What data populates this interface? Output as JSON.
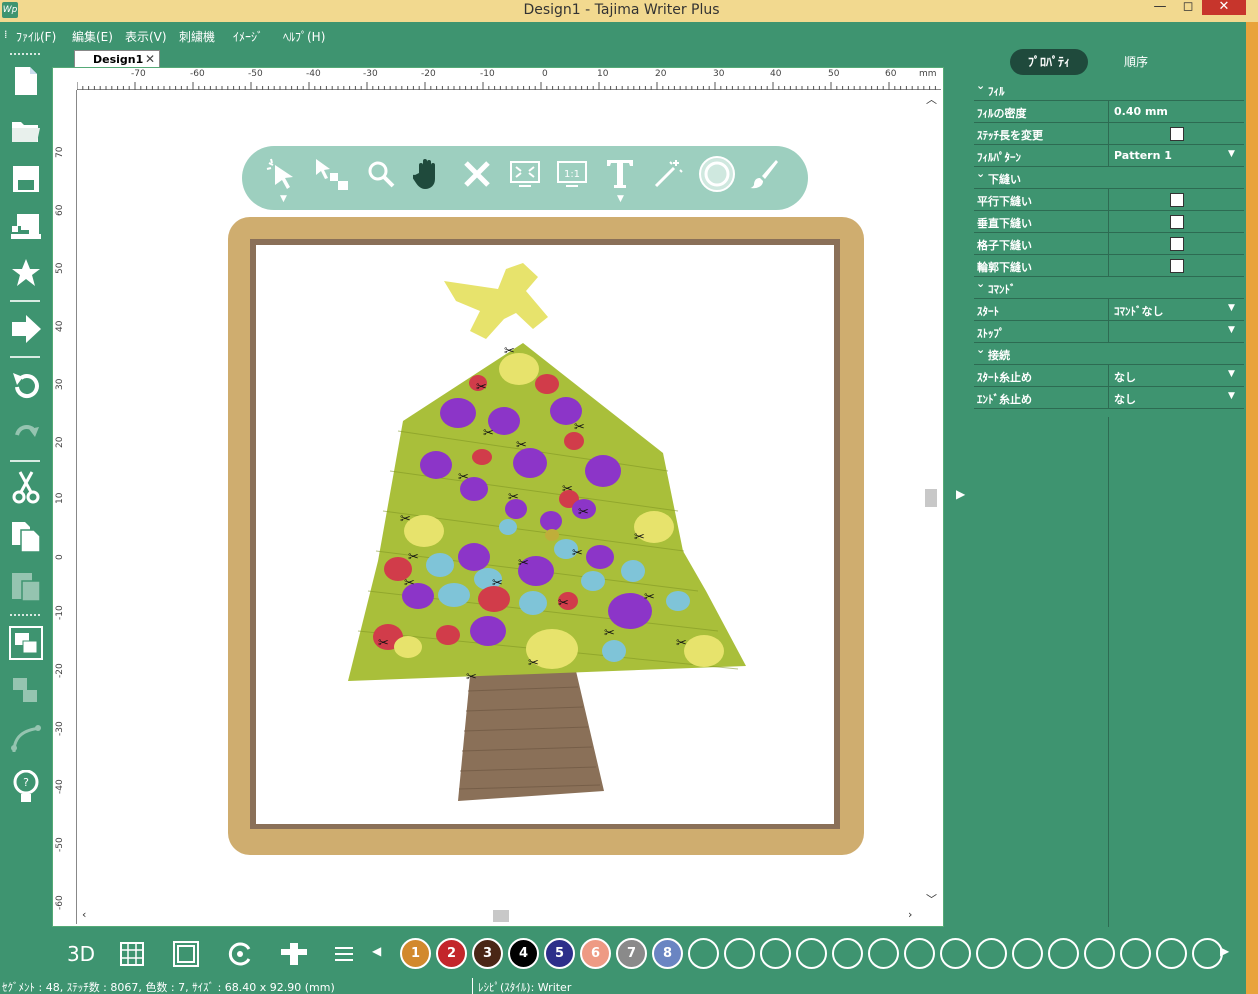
{
  "window": {
    "title": "Design1 - Tajima Writer Plus",
    "app_icon": "Wp",
    "minimize": "—",
    "maximize": "◻",
    "close": "✕"
  },
  "menu": [
    "ﾌｧｲﾙ(F)",
    "編集(E)",
    "表示(V)",
    "刺繍機",
    "ｲﾒｰｼﾞ",
    "ﾍﾙﾌﾟ(H)"
  ],
  "document": {
    "tab_label": "Design1",
    "ruler_unit": "mm",
    "ruler_top_ticks": [
      "-70",
      "-60",
      "-50",
      "-40",
      "-30",
      "-20",
      "-10",
      "0",
      "10",
      "20",
      "30",
      "40",
      "50",
      "60"
    ],
    "ruler_left_ticks": [
      "70",
      "60",
      "50",
      "40",
      "30",
      "20",
      "10",
      "0",
      "-10",
      "-20",
      "-30",
      "-40",
      "-50",
      "-60"
    ]
  },
  "left_toolbar": [
    {
      "icon": "new-file-icon"
    },
    {
      "icon": "open-folder-icon"
    },
    {
      "icon": "save-icon"
    },
    {
      "icon": "sewing-machine-icon"
    },
    {
      "icon": "star-icon"
    },
    {
      "icon": "export-icon"
    },
    {
      "icon": "undo-icon"
    },
    {
      "icon": "redo-icon"
    },
    {
      "icon": "cut-icon"
    },
    {
      "icon": "copy-icon"
    },
    {
      "icon": "paste-icon"
    },
    {
      "icon": "group-icon"
    },
    {
      "icon": "ungroup-icon"
    },
    {
      "icon": "node-edit-icon"
    },
    {
      "icon": "tip-bulb-icon"
    }
  ],
  "float_toolbar": [
    {
      "icon": "magic-select-icon"
    },
    {
      "icon": "select-icon"
    },
    {
      "icon": "zoom-icon"
    },
    {
      "icon": "hand-pan-icon"
    },
    {
      "icon": "delete-icon"
    },
    {
      "icon": "fit-screen-icon"
    },
    {
      "icon": "actual-size-icon"
    },
    {
      "icon": "text-icon"
    },
    {
      "icon": "magic-wand-icon"
    },
    {
      "icon": "stitch-view-icon"
    },
    {
      "icon": "brush-icon"
    }
  ],
  "properties_panel": {
    "tab_properties": "ﾌﾟﾛﾊﾟﾃｨ",
    "tab_order": "順序",
    "rows": [
      {
        "type": "section",
        "label": "ﾌｨﾙ"
      },
      {
        "type": "value",
        "label": "ﾌｨﾙの密度",
        "value": "0.40 mm"
      },
      {
        "type": "check",
        "label": "ｽﾃｯﾁ長を変更",
        "checked": false
      },
      {
        "type": "select",
        "label": "ﾌｨﾙﾊﾟﾀｰﾝ",
        "value": "Pattern  1"
      },
      {
        "type": "section",
        "label": "下縫い"
      },
      {
        "type": "check",
        "label": "平行下縫い",
        "checked": false
      },
      {
        "type": "check",
        "label": "垂直下縫い",
        "checked": false
      },
      {
        "type": "check",
        "label": "格子下縫い",
        "checked": false
      },
      {
        "type": "check",
        "label": "輪郭下縫い",
        "checked": false
      },
      {
        "type": "section",
        "label": "ｺﾏﾝﾄﾞ"
      },
      {
        "type": "select",
        "label": "ｽﾀｰﾄ",
        "value": "ｺﾏﾝﾄﾞなし"
      },
      {
        "type": "select",
        "label": "ｽﾄｯﾌﾟ",
        "value": ""
      },
      {
        "type": "section",
        "label": "接続"
      },
      {
        "type": "select",
        "label": "ｽﾀｰﾄ糸止め",
        "value": "なし"
      },
      {
        "type": "select",
        "label": "ｴﾝﾄﾞ糸止め",
        "value": "なし"
      }
    ]
  },
  "bottom_toolbar": {
    "view3d": "3D",
    "tools": [
      {
        "icon": "grid-icon"
      },
      {
        "icon": "hoop-icon"
      },
      {
        "icon": "stitch-path-icon"
      },
      {
        "icon": "trim-icon"
      },
      {
        "icon": "list-icon"
      }
    ],
    "swatches": [
      {
        "label": "1",
        "color": "#d2892d"
      },
      {
        "label": "2",
        "color": "#c3262b"
      },
      {
        "label": "3",
        "color": "#4a2716"
      },
      {
        "label": "4",
        "color": "#000000"
      },
      {
        "label": "5",
        "color": "#2d2f8a"
      },
      {
        "label": "6",
        "color": "#ee9a84"
      },
      {
        "label": "7",
        "color": "#8a8a8a"
      },
      {
        "label": "8",
        "color": "#6a85c2"
      }
    ],
    "empty_swatches": 15
  },
  "status": {
    "left": "ｾｸﾞﾒﾝﾄ : 48, ｽﾃｯﾁ数 : 8067, 色数 : 7, ｻｲｽﾞ : 68.40 x 92.90 (mm)",
    "right": "ﾚｼﾋﾟ(ｽﾀｲﾙ): Writer"
  },
  "colors": {
    "app_bg": "#3e9470",
    "title_bar": "#f2d98f",
    "frame": "#cfad6f",
    "tree": "#a9bf3a",
    "trunk": "#8a7058"
  }
}
